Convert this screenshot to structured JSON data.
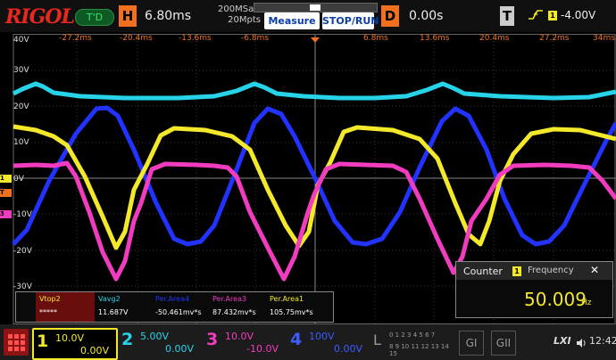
{
  "header": {
    "logo": "RIGOL",
    "mode_badge": "T'D",
    "horizontal_label": "H",
    "timebase": "6.80ms",
    "sample_rate": "200MSa/s",
    "memory_depth": "20Mpts",
    "measure_button": "Measure",
    "stop_run_button": "STOP/RUN",
    "delay_label": "D",
    "delay_value": "0.00s",
    "trigger_label": "T",
    "trigger_edge_icon": "rising-edge-icon",
    "trigger_source": "1",
    "trigger_level": "-4.00V"
  },
  "time_axis": [
    "-27.2ms",
    "-20.4ms",
    "-13.6ms",
    "-6.8ms",
    "6.8ms",
    "13.6ms",
    "20.4ms",
    "27.2ms",
    "34ms"
  ],
  "volt_axis": [
    "40V",
    "30V",
    "20V",
    "10V",
    "0V",
    "-10V",
    "-20V",
    "-30V"
  ],
  "channel_markers": [
    "1",
    "T",
    "3"
  ],
  "measurements": [
    {
      "name": "Vtop2",
      "value": "*****",
      "color": "#f3e92a"
    },
    {
      "name": "Vavg2",
      "value": "11.687V",
      "color": "#27d3e8"
    },
    {
      "name": "Per.Area4",
      "value": "-50.461mv*s",
      "color": "#2233ff"
    },
    {
      "name": "Per.Area3",
      "value": "87.432mv*s",
      "color": "#f23cc0"
    },
    {
      "name": "Per.Area1",
      "value": "105.75mv*s",
      "color": "#f3e92a"
    }
  ],
  "counter": {
    "title": "Counter",
    "source": "1",
    "mode": "Frequency",
    "close": "✕",
    "value": "50.009",
    "unit": "Hz"
  },
  "channels": [
    {
      "num": "1",
      "scale": "10.0V",
      "offset": "0.00V",
      "color": "#f3e92a"
    },
    {
      "num": "2",
      "scale": "5.00V",
      "offset": "0.00V",
      "color": "#27d3e8"
    },
    {
      "num": "3",
      "scale": "10.0V",
      "offset": "-10.0V",
      "color": "#f23cc0"
    },
    {
      "num": "4",
      "scale": "100V",
      "offset": "0.00V",
      "color": "#2233ff"
    }
  ],
  "logic": {
    "label": "L",
    "row1": "0 1 2 3 4 5 6 7",
    "row2": "8 9 10 11 12 13 14 15"
  },
  "decoders": [
    "GI",
    "GII"
  ],
  "status": {
    "lxi": "LXI",
    "time": "12:42"
  }
}
